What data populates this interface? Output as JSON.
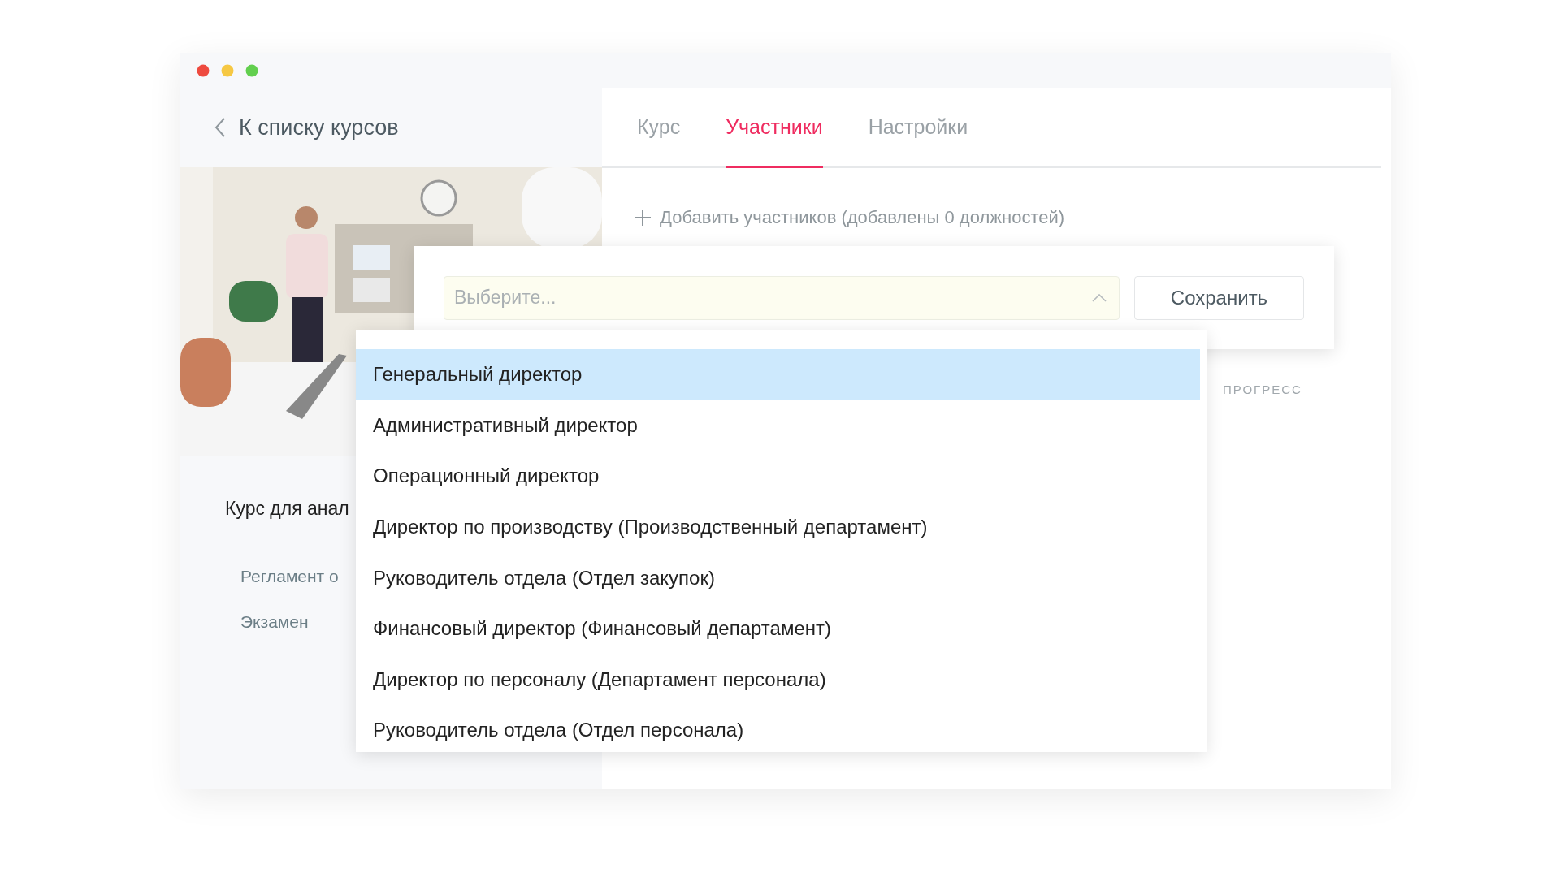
{
  "sidebar": {
    "back_link": "К списку курсов",
    "photo": {
      "kind": "picture"
    },
    "course_title": "Курс для анал",
    "lessons": [
      "Регламент о",
      "Экзамен"
    ]
  },
  "tabs": [
    {
      "label": "Курс",
      "selected": false
    },
    {
      "label": "Участники",
      "selected": true
    },
    {
      "label": "Настройки",
      "selected": false
    }
  ],
  "add_participants": "Добавить участников (добавлены 0 должностей)",
  "popup": {
    "select": {
      "placeholder": "Выберите...",
      "expanded": true
    },
    "save_button": "Сохранить"
  },
  "dropdown": {
    "options": [
      {
        "label": "Генеральный директор",
        "selected": true
      },
      {
        "label": "Административный директор",
        "selected": false
      },
      {
        "label": "Операционный директор",
        "selected": false
      },
      {
        "label": "Директор по производству (Производственный департамент)",
        "selected": false
      },
      {
        "label": "Руководитель отдела (Отдел закупок)",
        "selected": false
      },
      {
        "label": "Финансовый директор (Финансовый департамент)",
        "selected": false
      },
      {
        "label": "Директор по персоналу (Департамент персонала)",
        "selected": false
      },
      {
        "label": "Руководитель отдела (Отдел персонала)",
        "selected": false
      }
    ]
  },
  "table": {
    "columns": [
      "ПРОГРЕСС"
    ]
  }
}
